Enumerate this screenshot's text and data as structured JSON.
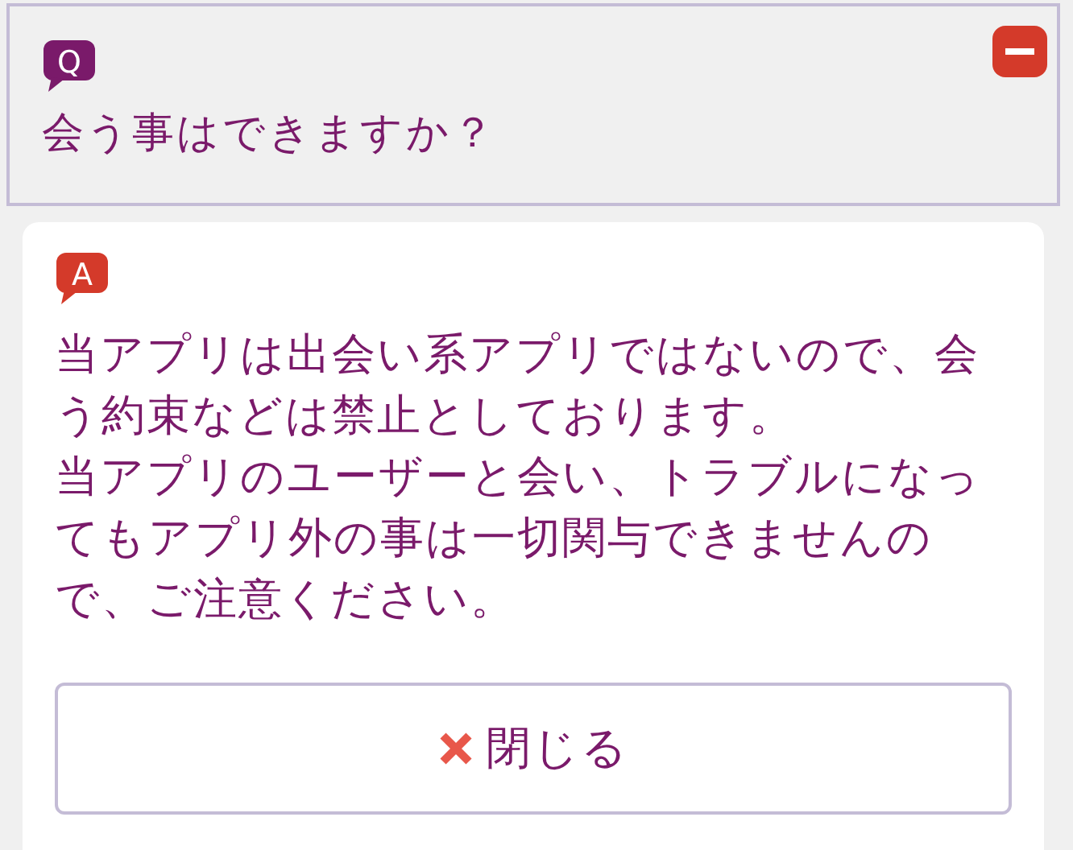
{
  "faq": {
    "expanded": true,
    "question": {
      "badge": "Q",
      "text": "会う事はできますか？"
    },
    "answer": {
      "badge": "A",
      "paragraphs": [
        "当アプリは出会い系アプリではないので、会う約束などは禁止としております。",
        "当アプリのユーザーと会い、トラブルになってもアプリ外の事は一切関与できませんので、ご注意ください。"
      ]
    },
    "close_button": {
      "label": "閉じる"
    }
  }
}
